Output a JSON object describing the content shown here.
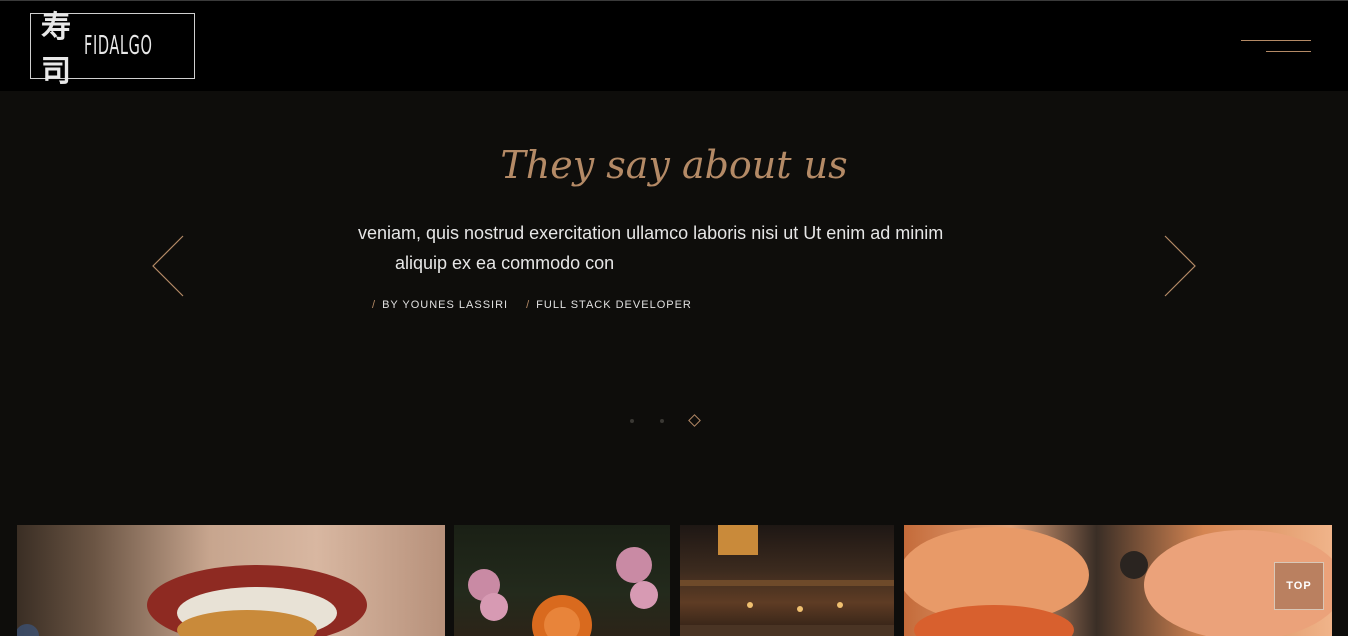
{
  "header": {
    "logo_kanji": "寿司",
    "logo_text": "FIDALGO"
  },
  "testimonial": {
    "title": "They say about us",
    "quote_line1": "veniam, quis nostrud exercitation ullamco laboris nisi ut    Ut enim ad minim",
    "quote_line2": "aliquip ex ea commodo con",
    "author": "BY YOUNES LASSIRI",
    "role": "FULL STACK DEVELOPER",
    "active_slide": 3,
    "slide_count": 3
  },
  "back_to_top": {
    "label": "TOP"
  },
  "colors": {
    "accent": "#b48a66",
    "background": "#0e0d0b",
    "header": "#000000"
  },
  "icons": {
    "prev": "chevron-left-icon",
    "next": "chevron-right-icon",
    "menu": "hamburger-icon"
  }
}
